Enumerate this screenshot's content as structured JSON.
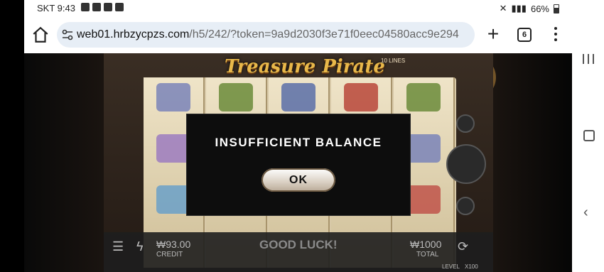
{
  "status_bar": {
    "time": "SKT 9:43",
    "battery": "66%"
  },
  "browser": {
    "url_domain": "web01.hrbzycpzs.com",
    "url_path": "/h5/242/?token=9a9d2030f3e71f0eec04580acc9e294",
    "tab_count": "6"
  },
  "game": {
    "title": "Treasure Pirate",
    "lines_badge": "10 LINES",
    "credit_value": "₩93.00",
    "credit_label": "CREDIT",
    "status_text": "GOOD LUCK!",
    "total_value": "₩1000",
    "total_label": "TOTAL",
    "level_label": "LEVEL",
    "multiplier": "X100"
  },
  "dialog": {
    "message": "INSUFFICIENT BALANCE",
    "ok_label": "OK"
  },
  "colors": {
    "logo_gold": "#e8b84a",
    "dialog_bg": "#0d0d0d"
  }
}
